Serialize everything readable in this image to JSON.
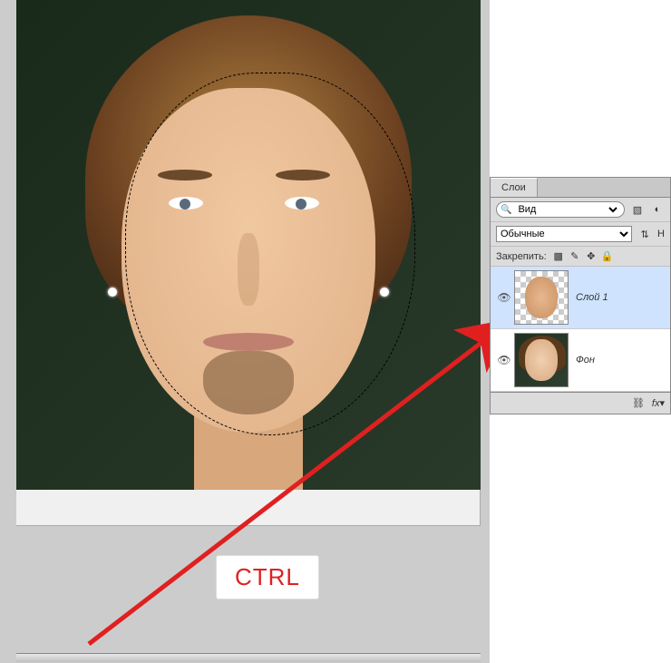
{
  "panel": {
    "title": "Слои",
    "search_label": "Вид",
    "blend_mode": "Обычные",
    "lock_label": "Закрепить:"
  },
  "layers": [
    {
      "name": "Слой 1",
      "visible": true,
      "selected": true
    },
    {
      "name": "Фон",
      "visible": true,
      "selected": false
    }
  ],
  "annotation": {
    "ctrl_label": "CTRL"
  },
  "opacity_label_cut": "Н"
}
